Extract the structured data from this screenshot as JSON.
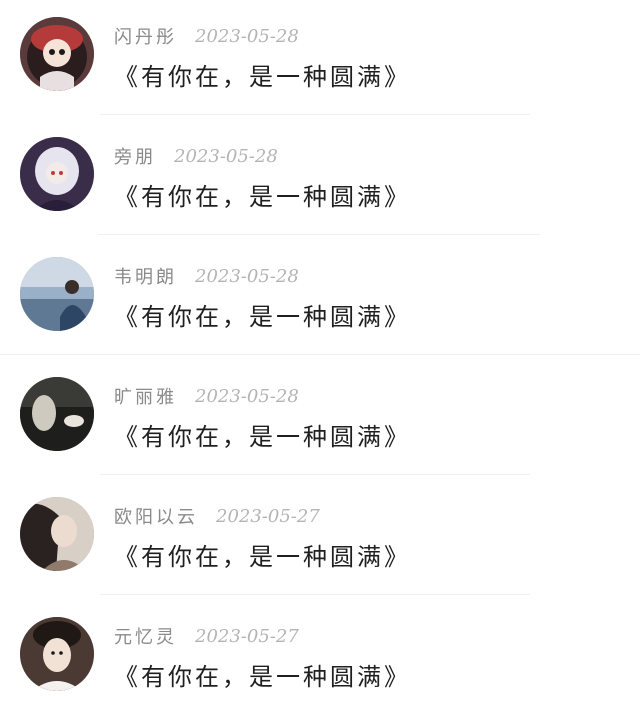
{
  "comments": [
    {
      "username": "闪丹彤",
      "date": "2023-05-28",
      "text": "《有你在，是一种圆满》",
      "avatar_icon": "anime-girl-red-hood-avatar"
    },
    {
      "username": "旁朋",
      "date": "2023-05-28",
      "text": "《有你在，是一种圆满》",
      "avatar_icon": "anime-white-hair-girl-avatar"
    },
    {
      "username": "韦明朗",
      "date": "2023-05-28",
      "text": "《有你在，是一种圆满》",
      "avatar_icon": "man-seated-blue-scene-avatar"
    },
    {
      "username": "旷丽雅",
      "date": "2023-05-28",
      "text": "《有你在，是一种圆满》",
      "avatar_icon": "dark-moody-portrait-avatar"
    },
    {
      "username": "欧阳以云",
      "date": "2023-05-27",
      "text": "《有你在，是一种圆满》",
      "avatar_icon": "woman-dark-hair-portrait-avatar"
    },
    {
      "username": "元忆灵",
      "date": "2023-05-27",
      "text": "《有你在，是一种圆满》",
      "avatar_icon": "woman-traditional-dress-avatar"
    }
  ]
}
